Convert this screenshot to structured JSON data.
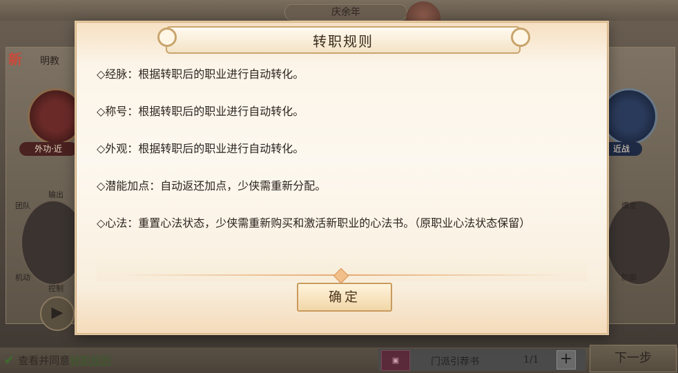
{
  "background": {
    "top_name": "庆余年",
    "new_tag": "新",
    "sect_name": "明教",
    "left_badge": "外功·近",
    "right_badge": "近战",
    "radar_labels": {
      "top": "输出",
      "team": "团队",
      "burst": "爆发",
      "mobility": "机动",
      "control": "控制",
      "defense": "防御"
    }
  },
  "modal": {
    "title": "转职规则",
    "rules": [
      "◇经脉：根据转职后的职业进行自动转化。",
      "◇称号：根据转职后的职业进行自动转化。",
      "◇外观：根据转职后的职业进行自动转化。",
      "◇潜能加点：自动返还加点，少侠需重新分配。",
      "◇心法：重置心法状态，少侠需重新购买和激活新职业的心法书。（原职业心法状态保留）"
    ],
    "confirm_label": "确定"
  },
  "bottom": {
    "agree_prefix": "查看并同意",
    "agree_link": "转职规则",
    "item_name": "门派引荐书",
    "item_count": "1/1",
    "plus_label": "+",
    "next_label": "下一步"
  },
  "colors": {
    "modal_bg": "#fdf8ef",
    "modal_border": "#e2c8a0",
    "button_bg": "#f1d7a8",
    "text": "#2b2520"
  }
}
